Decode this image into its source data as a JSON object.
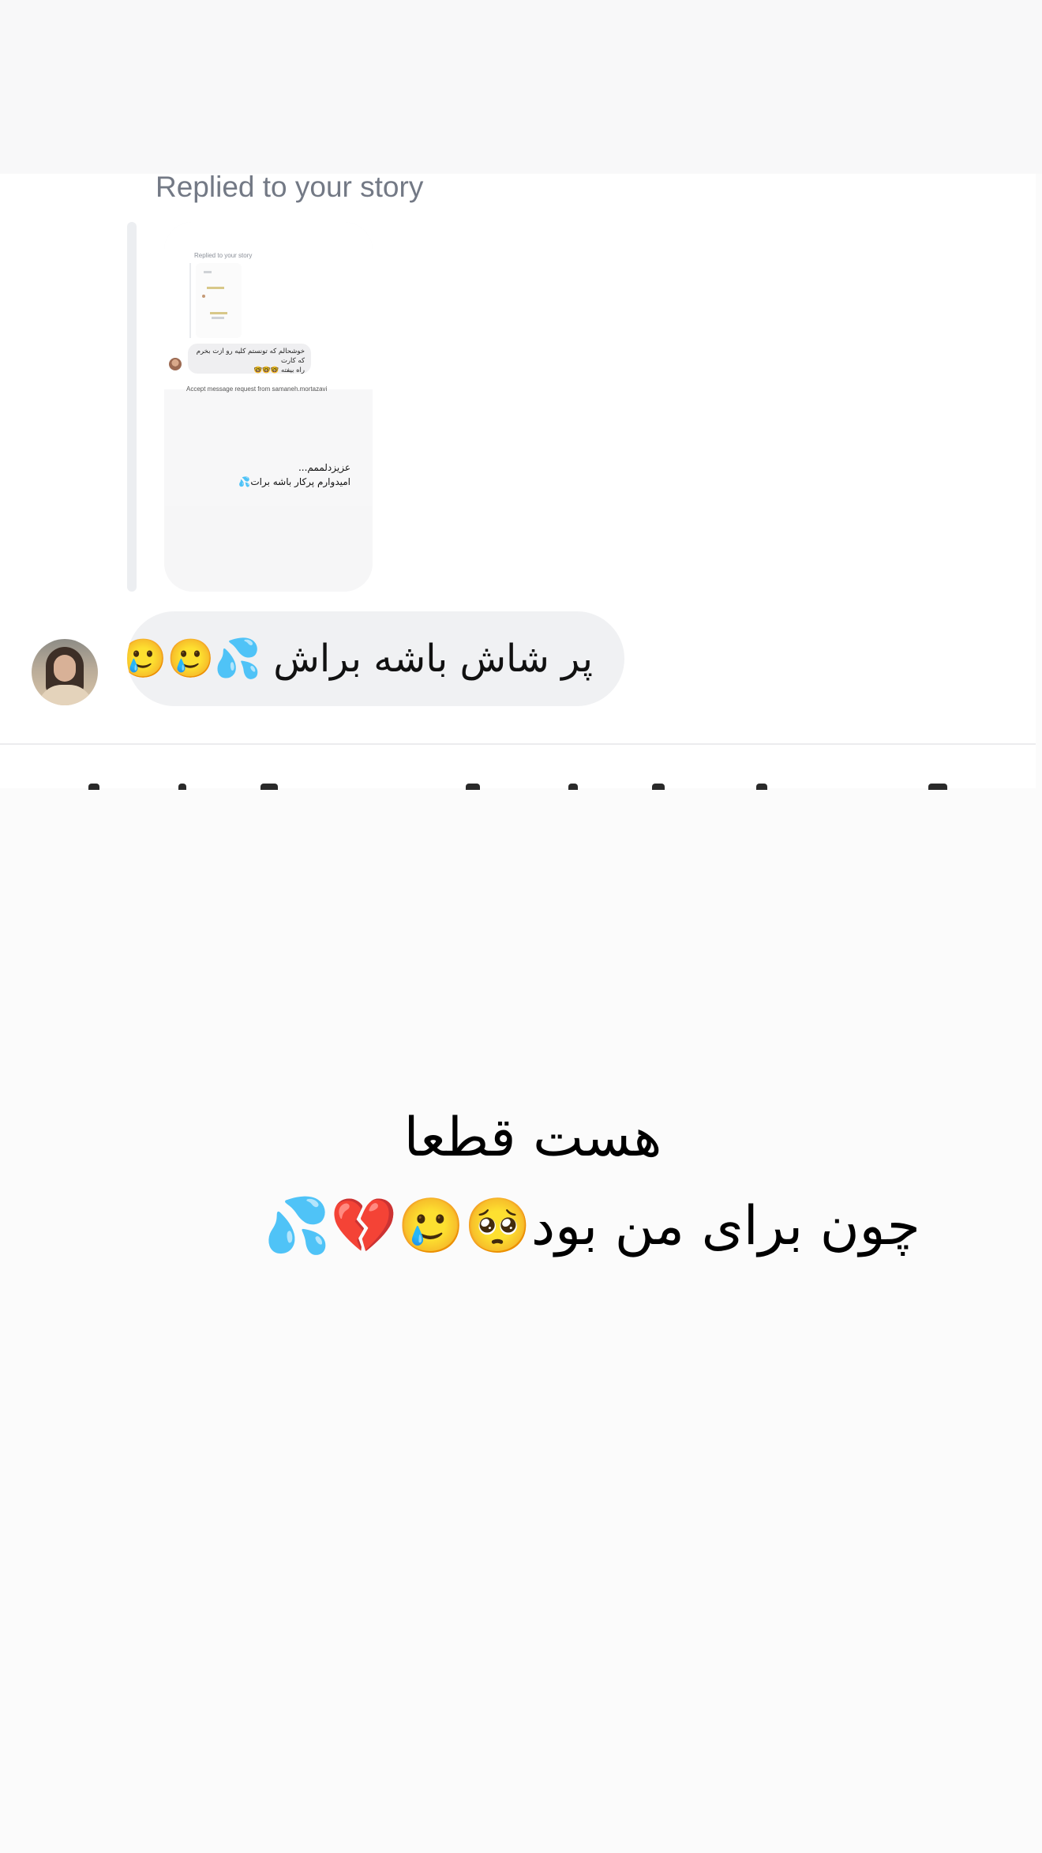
{
  "story_reply": {
    "label": "Replied to your story",
    "preview": {
      "label": "Replied to your story",
      "message_line1": "خوشحالم که تونستم کلیه رو ازت بخرم که کارت",
      "message_line2": "راه بیفته 🤓🤓🤓",
      "request_text": "Accept message request from samaneh.mortazavi",
      "quote_line1": "عزیزدلممم...",
      "quote_line2": "امیدوارم پرکار باشه برات💦"
    }
  },
  "message": {
    "text": "پر شاش باشه براش 💦🥲🥲🥲"
  },
  "caption": {
    "line1": "هست قطعا",
    "line2": "چون برای من بود🥺🥲💔💦"
  }
}
